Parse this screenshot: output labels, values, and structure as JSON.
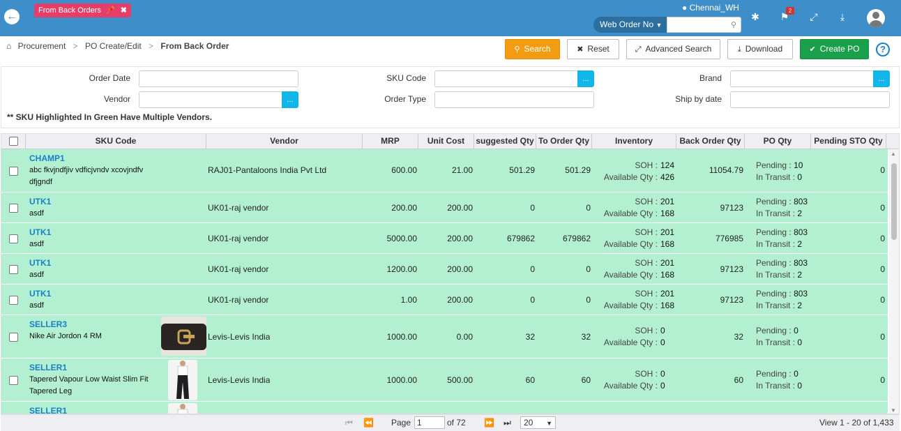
{
  "topbar": {
    "tab_label": "From Back Orders",
    "location": "Chennai_WH",
    "search_select": "Web Order No",
    "search_value": "",
    "notification_count": "2"
  },
  "breadcrumb": {
    "items": [
      "Procurement",
      "PO Create/Edit",
      "From Back Order"
    ]
  },
  "toolbar": {
    "search": "Search",
    "reset": "Reset",
    "advanced_search": "Advanced Search",
    "download": "Download",
    "create_po": "Create PO",
    "help": "?"
  },
  "filters": {
    "order_date": "Order Date",
    "sku_code": "SKU Code",
    "brand": "Brand",
    "vendor": "Vendor",
    "order_type": "Order Type",
    "ship_by_date": "Ship by date",
    "lookup": "...",
    "note": "** SKU Highlighted In Green Have Multiple Vendors."
  },
  "grid": {
    "headers": [
      "SKU Code",
      "Vendor",
      "MRP",
      "Unit Cost",
      "suggested Qty",
      "To Order Qty",
      "Inventory",
      "Back Order Qty",
      "PO Qty",
      "Pending STO Qty"
    ],
    "soh_label": "SOH :",
    "avail_label": "Available Qty :",
    "pending_label": "Pending :",
    "transit_label": "In Transit :",
    "rows": [
      {
        "sku": "CHAMP1",
        "desc1": "abc fkvjndfjiv vdficjvndv xcovjndfv",
        "desc2": "dfjgndf",
        "vendor": "RAJ01-Pantaloons India Pvt Ltd",
        "mrp": "600.00",
        "unit_cost": "21.00",
        "suggested": "501.29",
        "to_order": "501.29",
        "soh": "124",
        "avail": "426",
        "back_order": "11054.79",
        "pending": "10",
        "transit": "0",
        "sto": "0"
      },
      {
        "sku": "UTK1",
        "desc1": "asdf",
        "desc2": "",
        "vendor": "UK01-raj vendor",
        "mrp": "200.00",
        "unit_cost": "200.00",
        "suggested": "0",
        "to_order": "0",
        "soh": "201",
        "avail": "168",
        "back_order": "97123",
        "pending": "803",
        "transit": "2",
        "sto": "0"
      },
      {
        "sku": "UTK1",
        "desc1": "asdf",
        "desc2": "",
        "vendor": "UK01-raj vendor",
        "mrp": "5000.00",
        "unit_cost": "200.00",
        "suggested": "679862",
        "to_order": "679862",
        "soh": "201",
        "avail": "168",
        "back_order": "776985",
        "pending": "803",
        "transit": "2",
        "sto": "0"
      },
      {
        "sku": "UTK1",
        "desc1": "asdf",
        "desc2": "",
        "vendor": "UK01-raj vendor",
        "mrp": "1200.00",
        "unit_cost": "200.00",
        "suggested": "0",
        "to_order": "0",
        "soh": "201",
        "avail": "168",
        "back_order": "97123",
        "pending": "803",
        "transit": "2",
        "sto": "0"
      },
      {
        "sku": "UTK1",
        "desc1": "asdf",
        "desc2": "",
        "vendor": "UK01-raj vendor",
        "mrp": "1.00",
        "unit_cost": "200.00",
        "suggested": "0",
        "to_order": "0",
        "soh": "201",
        "avail": "168",
        "back_order": "97123",
        "pending": "803",
        "transit": "2",
        "sto": "0"
      },
      {
        "sku": "SELLER3",
        "desc1": "Nike Air Jordon 4 RM",
        "desc2": "",
        "vendor": "Levis-Levis India",
        "mrp": "1000.00",
        "unit_cost": "0.00",
        "suggested": "32",
        "to_order": "32",
        "soh": "0",
        "avail": "0",
        "back_order": "32",
        "pending": "0",
        "transit": "0",
        "sto": "0"
      },
      {
        "sku": "SELLER1",
        "desc1": "Tapered Vapour Low Waist Slim Fit",
        "desc2": "Tapered Leg",
        "vendor": "Levis-Levis India",
        "mrp": "1000.00",
        "unit_cost": "500.00",
        "suggested": "60",
        "to_order": "60",
        "soh": "0",
        "avail": "0",
        "back_order": "60",
        "pending": "0",
        "transit": "0",
        "sto": "0"
      },
      {
        "sku": "SELLER1",
        "desc1": "",
        "desc2": "",
        "vendor": "",
        "mrp": "",
        "unit_cost": "",
        "suggested": "",
        "to_order": "",
        "soh": "",
        "avail": "",
        "back_order": "",
        "pending": "",
        "transit": "",
        "sto": ""
      }
    ]
  },
  "pager": {
    "page_label": "Page",
    "page_value": "1",
    "of_label": "of 72",
    "page_size": "20",
    "view_label": "View 1 - 20 of 1,433"
  }
}
